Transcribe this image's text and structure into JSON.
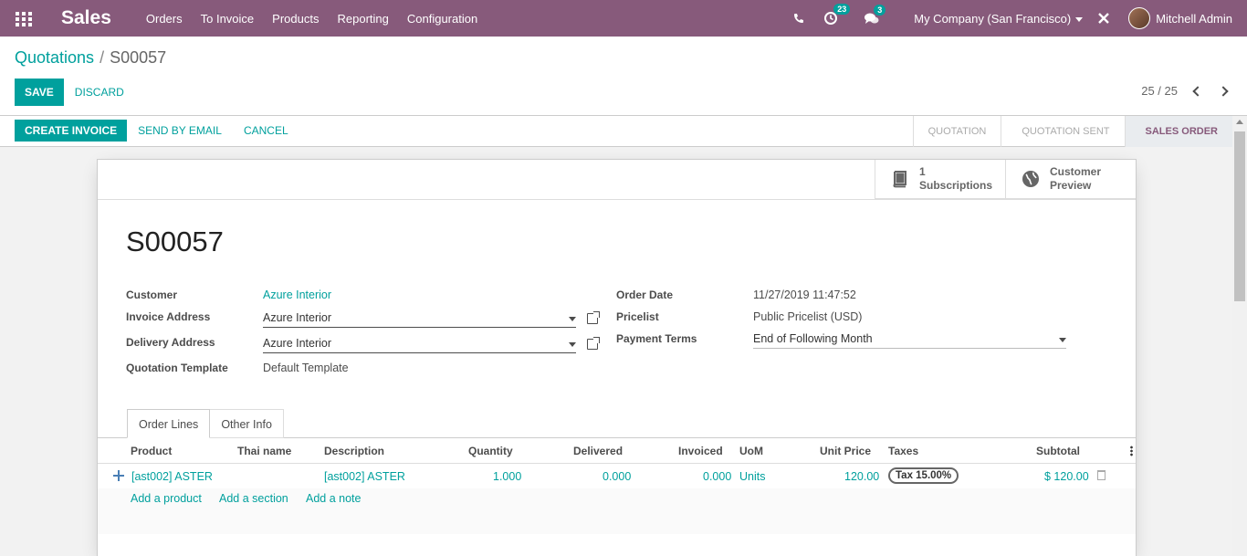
{
  "navbar": {
    "brand": "Sales",
    "menu": [
      "Orders",
      "To Invoice",
      "Products",
      "Reporting",
      "Configuration"
    ],
    "activity_count": "23",
    "message_count": "3",
    "company": "My Company (San Francisco)",
    "user": "Mitchell Admin",
    "bg_color": "#875a7b"
  },
  "breadcrumb": {
    "parent": "Quotations",
    "current": "S00057"
  },
  "form_buttons": {
    "save": "SAVE",
    "discard": "DISCARD"
  },
  "pager": "25 / 25",
  "statusbar": {
    "create_invoice": "CREATE INVOICE",
    "send_by_email": "SEND BY EMAIL",
    "cancel": "CANCEL",
    "stages": [
      "QUOTATION",
      "QUOTATION SENT",
      "SALES ORDER"
    ],
    "active_stage": "SALES ORDER"
  },
  "smart_buttons": {
    "subscriptions_count": "1",
    "subscriptions_label": "Subscriptions",
    "preview_line1": "Customer",
    "preview_line2": "Preview"
  },
  "order": {
    "name": "S00057",
    "customer_label": "Customer",
    "customer": "Azure Interior",
    "invoice_address_label": "Invoice Address",
    "invoice_address": "Azure Interior",
    "delivery_address_label": "Delivery Address",
    "delivery_address": "Azure Interior",
    "template_label": "Quotation Template",
    "template": "Default Template",
    "order_date_label": "Order Date",
    "order_date": "11/27/2019 11:47:52",
    "pricelist_label": "Pricelist",
    "pricelist": "Public Pricelist (USD)",
    "payment_terms_label": "Payment Terms",
    "payment_terms": "End of Following Month"
  },
  "tabs": [
    "Order Lines",
    "Other Info"
  ],
  "lines": {
    "headers": [
      "Product",
      "Thai name",
      "Description",
      "Quantity",
      "Delivered",
      "Invoiced",
      "UoM",
      "Unit Price",
      "Taxes",
      "Subtotal"
    ],
    "rows": [
      {
        "product": "[ast002] ASTER",
        "thai_name": "",
        "description": "[ast002] ASTER",
        "quantity": "1.000",
        "delivered": "0.000",
        "invoiced": "0.000",
        "uom": "Units",
        "unit_price": "120.00",
        "taxes": "Tax 15.00%",
        "subtotal": "$ 120.00"
      }
    ],
    "add_product": "Add a product",
    "add_section": "Add a section",
    "add_note": "Add a note"
  },
  "accent_color": "#00a09d"
}
